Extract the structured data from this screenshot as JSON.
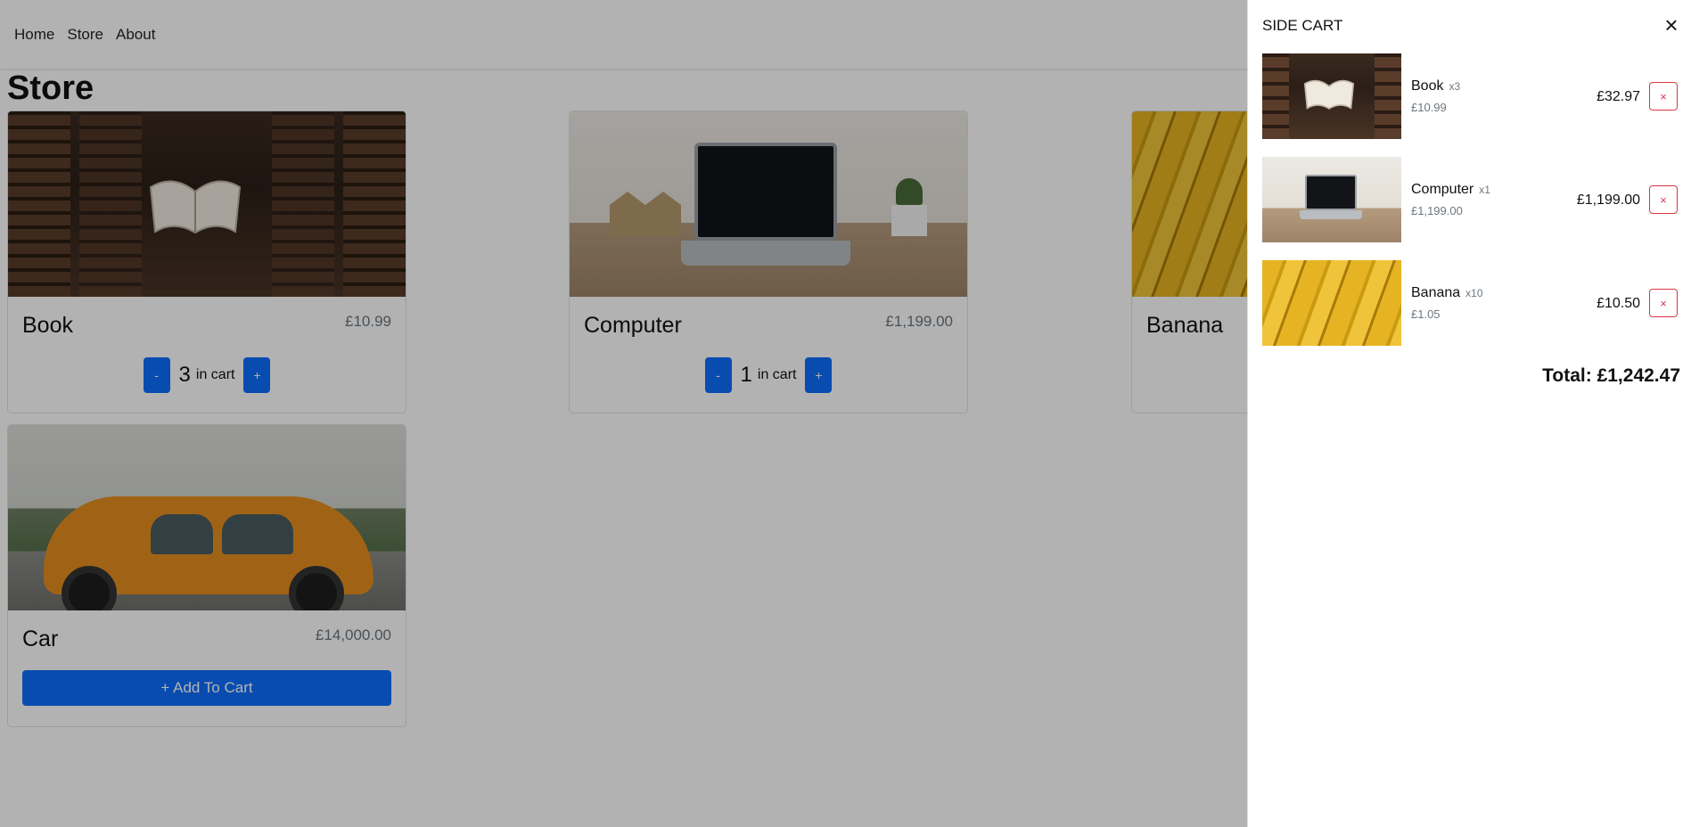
{
  "nav": {
    "items": [
      "Home",
      "Store",
      "About"
    ]
  },
  "page": {
    "title": "Store"
  },
  "products": [
    {
      "name": "Book",
      "price": "£10.99",
      "qty": "3",
      "in_cart_label": "in cart",
      "minus": "-",
      "plus": "+"
    },
    {
      "name": "Computer",
      "price": "£1,199.00",
      "qty": "1",
      "in_cart_label": "in cart",
      "minus": "-",
      "plus": "+"
    },
    {
      "name": "Banana"
    },
    {
      "name": "Car",
      "price": "£14,000.00",
      "add_label": "+ Add To Cart"
    }
  ],
  "cart": {
    "title": "SIDE CART",
    "close_icon": "×",
    "items": [
      {
        "name": "Book",
        "qty": "x3",
        "unit": "£10.99",
        "subtotal": "£32.97",
        "remove": "×"
      },
      {
        "name": "Computer",
        "qty": "x1",
        "unit": "£1,199.00",
        "subtotal": "£1,199.00",
        "remove": "×"
      },
      {
        "name": "Banana",
        "qty": "x10",
        "unit": "£1.05",
        "subtotal": "£10.50",
        "remove": "×"
      }
    ],
    "total": "Total: £1,242.47"
  },
  "colors": {
    "primary": "#0d6efd",
    "danger": "#dc3545",
    "overlay": "rgba(0,0,0,0.3)"
  }
}
